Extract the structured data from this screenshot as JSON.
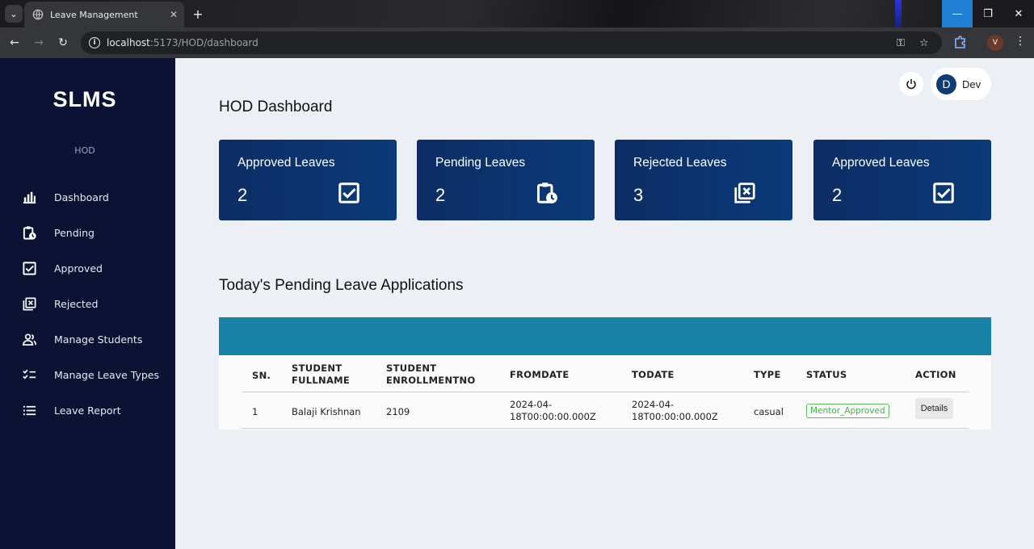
{
  "browser": {
    "tab_title": "Leave Management",
    "url_host": "localhost",
    "url_path": ":5173/HOD/dashboard",
    "profile_initial": "V"
  },
  "sidebar": {
    "brand": "SLMS",
    "role": "HOD",
    "items": [
      {
        "label": "Dashboard",
        "icon": "bar-chart-icon"
      },
      {
        "label": "Pending",
        "icon": "clipboard-clock-icon"
      },
      {
        "label": "Approved",
        "icon": "check-box-icon"
      },
      {
        "label": "Rejected",
        "icon": "library-x-icon"
      },
      {
        "label": "Manage Students",
        "icon": "people-icon"
      },
      {
        "label": "Manage Leave Types",
        "icon": "checklist-icon"
      },
      {
        "label": "Leave Report",
        "icon": "list-icon"
      }
    ]
  },
  "header": {
    "user_initial": "D",
    "user_name": "Dev"
  },
  "page_title": "HOD Dashboard",
  "cards": [
    {
      "title": "Approved Leaves",
      "value": "2",
      "icon": "check-box-icon"
    },
    {
      "title": "Pending Leaves",
      "value": "2",
      "icon": "clipboard-clock-icon"
    },
    {
      "title": "Rejected Leaves",
      "value": "3",
      "icon": "library-x-icon"
    },
    {
      "title": "Approved Leaves",
      "value": "2",
      "icon": "check-box-icon"
    }
  ],
  "section_title": "Today's Pending Leave Applications",
  "table": {
    "headers": {
      "sn": "SN.",
      "fullname_1": "STUDENT",
      "fullname_2": "FULLNAME",
      "enroll_1": "STUDENT",
      "enroll_2": "ENROLLMENTNO",
      "from": "FROMDATE",
      "to": "TODATE",
      "type": "TYPE",
      "status": "STATUS",
      "action": "ACTION"
    },
    "rows": [
      {
        "sn": "1",
        "fullname": "Balaji Krishnan",
        "enrollment": "2109",
        "from_1": "2024-04-",
        "from_2": "18T00:00:00.000Z",
        "to_1": "2024-04-",
        "to_2": "18T00:00:00.000Z",
        "type": "casual",
        "status": "Mentor_Approved",
        "action": "Details"
      }
    ]
  },
  "colors": {
    "sidebar_bg": "#0c1233",
    "card_bg": "#0d2d64",
    "table_band": "#1782a6",
    "status_green": "#4caf50"
  }
}
